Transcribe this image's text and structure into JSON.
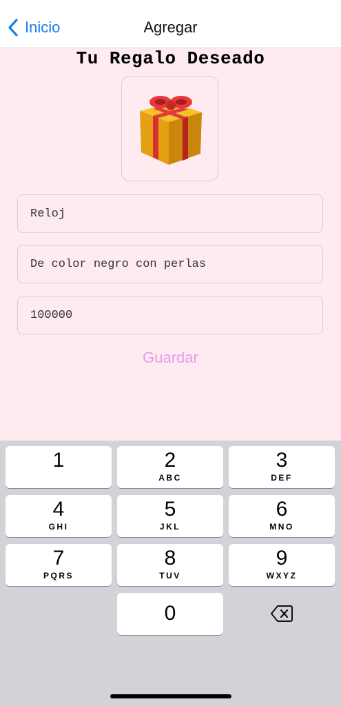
{
  "nav": {
    "back_label": "Inicio",
    "title": "Agregar"
  },
  "main": {
    "heading": "Tu Regalo Deseado",
    "image_icon": "wrapped-gift-emoji",
    "fields": [
      {
        "value": "Reloj"
      },
      {
        "value": "De color negro con perlas"
      },
      {
        "value": "100000"
      }
    ],
    "save_label": "Guardar"
  },
  "keypad": {
    "keys": [
      {
        "num": "1",
        "letters": ""
      },
      {
        "num": "2",
        "letters": "ABC"
      },
      {
        "num": "3",
        "letters": "DEF"
      },
      {
        "num": "4",
        "letters": "GHI"
      },
      {
        "num": "5",
        "letters": "JKL"
      },
      {
        "num": "6",
        "letters": "MNO"
      },
      {
        "num": "7",
        "letters": "PQRS"
      },
      {
        "num": "8",
        "letters": "TUV"
      },
      {
        "num": "9",
        "letters": "WXYZ"
      },
      {
        "num": "0",
        "letters": ""
      }
    ],
    "delete_icon": "backspace-icon"
  },
  "colors": {
    "accent": "#1a7cf0",
    "background": "#fdebf0",
    "save_text": "#e49bf0",
    "keypad_bg": "#d1d3d9"
  }
}
